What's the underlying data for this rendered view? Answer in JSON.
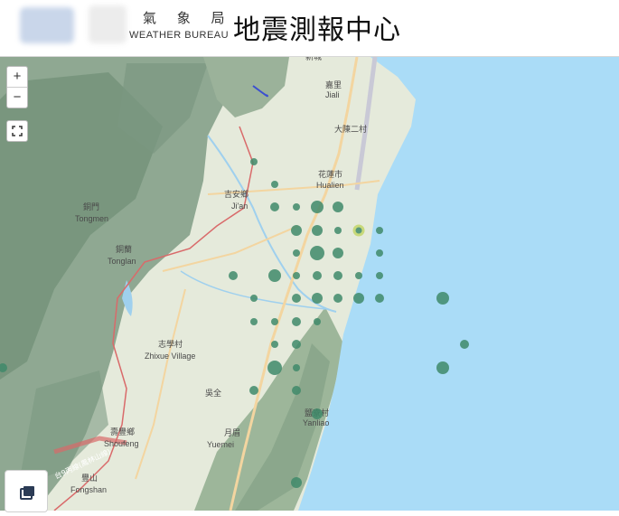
{
  "header": {
    "bureau_cn": "氣 象 局",
    "bureau_en": "WEATHER BUREAU",
    "title": "地震測報中心"
  },
  "controls": {
    "zoom_in": "+",
    "zoom_out": "−",
    "fullscreen_icon": "fullscreen-icon",
    "layers_icon": "layers-icon"
  },
  "places": [
    {
      "cn": "嘉里",
      "en": "Jiali"
    },
    {
      "cn": "大陳二村",
      "en": ""
    },
    {
      "cn": "花蓮市",
      "en": "Hualien"
    },
    {
      "cn": "吉安鄉",
      "en": "Ji'an"
    },
    {
      "cn": "銅門",
      "en": "Tongmen"
    },
    {
      "cn": "銅蘭",
      "en": "Tonglan"
    },
    {
      "cn": "志學村",
      "en": "Zhixue Village"
    },
    {
      "cn": "吳全",
      "en": ""
    },
    {
      "cn": "鹽寮村",
      "en": "Yanliao"
    },
    {
      "cn": "壽豐鄉",
      "en": "Shoufeng"
    },
    {
      "cn": "月眉",
      "en": "Yuemei"
    },
    {
      "cn": "豐山",
      "en": "Fongshan"
    },
    {
      "cn": "新城",
      "en": ""
    }
  ],
  "highway_label": "台9丙線(鳳林山線)",
  "colors": {
    "sea": "#aadcf7",
    "marker": "#3f8a6a",
    "marker_highlight": "#c8d97a",
    "boundary": "#d96a6a"
  }
}
